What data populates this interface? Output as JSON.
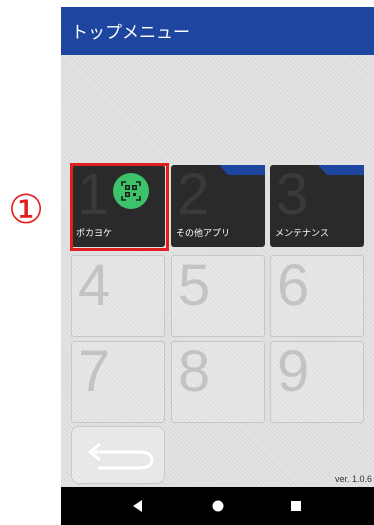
{
  "callout": {
    "marker": "①",
    "color": "#e02020"
  },
  "app_bar": {
    "title": "トップメニュー",
    "color": "#1e46a0"
  },
  "tiles": [
    {
      "number": "1",
      "label": "ポカヨケ",
      "icon": "qr-code-icon",
      "type": "app",
      "selected": true
    },
    {
      "number": "2",
      "label": "その他アプリ",
      "type": "folder"
    },
    {
      "number": "3",
      "label": "メンテナンス",
      "type": "folder"
    },
    {
      "number": "4",
      "label": "",
      "type": "empty"
    },
    {
      "number": "5",
      "label": "",
      "type": "empty"
    },
    {
      "number": "6",
      "label": "",
      "type": "empty"
    },
    {
      "number": "7",
      "label": "",
      "type": "empty"
    },
    {
      "number": "8",
      "label": "",
      "type": "empty"
    },
    {
      "number": "9",
      "label": "",
      "type": "empty"
    }
  ],
  "back_button": {
    "icon": "return-arrow-icon"
  },
  "version": "ver. 1.0.6",
  "nav_bar": {
    "buttons": [
      "back-triangle-icon",
      "home-circle-icon",
      "recents-square-icon"
    ]
  }
}
